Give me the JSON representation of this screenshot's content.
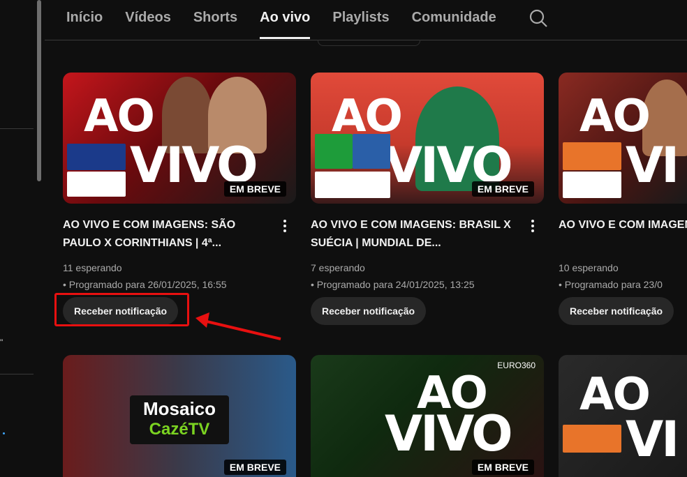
{
  "nav": {
    "tabs": [
      {
        "label": "Início"
      },
      {
        "label": "Vídeos"
      },
      {
        "label": "Shorts"
      },
      {
        "label": "Ao vivo",
        "active": true
      },
      {
        "label": "Playlists"
      },
      {
        "label": "Comunidade"
      }
    ],
    "search_icon": "search-icon"
  },
  "left_strip": {
    "glyph": "\""
  },
  "cards": [
    {
      "title": "AO VIVO E COM IMAGENS: SÃO PAULO X CORINTHIANS | 4ª...",
      "waiting": "11 esperando",
      "scheduled": "• Programado para 26/01/2025, 16:55",
      "notify_label": "Receber notificação",
      "thumb": {
        "ao": "AO",
        "vivo": "VIVO",
        "badge": "EM BREVE",
        "accent": "#b3141c"
      }
    },
    {
      "title": "AO VIVO E COM IMAGENS: BRASIL X SUÉCIA | MUNDIAL DE...",
      "waiting": "7 esperando",
      "scheduled": "• Programado para 24/01/2025, 13:25",
      "notify_label": "Receber notificação",
      "thumb": {
        "ao": "AO",
        "vivo": "VIVO",
        "badge": "EM BREVE",
        "accent": "#e0483c"
      }
    },
    {
      "title": "AO VIVO E COM IMAGENS: MANCHESTER UNITED",
      "waiting": "10 esperando",
      "scheduled": "• Programado para 23/0",
      "notify_label": "Receber notificação",
      "thumb": {
        "ao": "AO",
        "vivo": "VI",
        "badge": "",
        "accent": "#7a1f1a"
      }
    }
  ],
  "row2": [
    {
      "logo_line1": "Mosaico",
      "logo_line2": "CazéTV",
      "badge": "EM BREVE"
    },
    {
      "ao": "AO",
      "vivo": "VIVO",
      "tag": "EURO360",
      "badge": "EM BREVE"
    },
    {
      "ao": "AO",
      "vivo": "VI"
    }
  ],
  "colors": {
    "bg": "#0f0f0f",
    "button": "#272727",
    "highlight": "#e81010",
    "text_secondary": "#aaaaaa"
  }
}
